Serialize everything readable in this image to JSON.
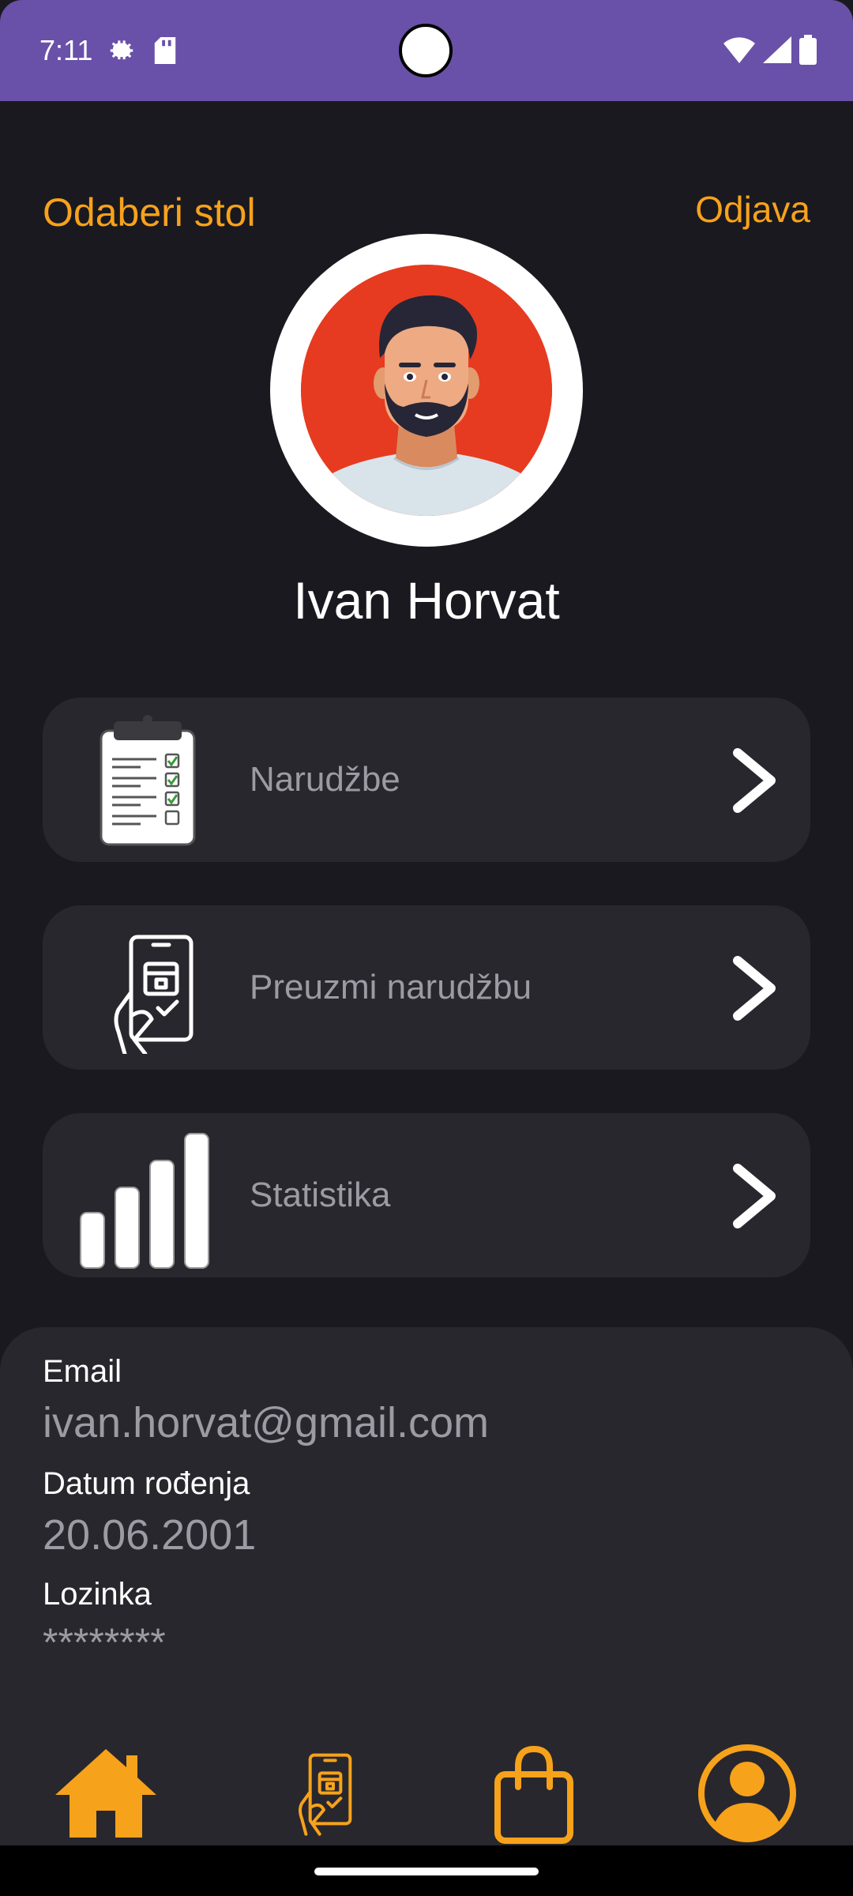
{
  "status_bar": {
    "time": "7:11",
    "icons": [
      "settings-gear-icon",
      "sd-card-icon",
      "wifi-icon",
      "signal-icon",
      "battery-icon"
    ]
  },
  "header": {
    "select_table_link": "Odaberi stol",
    "logout_link": "Odjava"
  },
  "profile": {
    "name": "Ivan Horvat",
    "avatar": "man-avatar-illustration"
  },
  "menu": {
    "items": [
      {
        "label": "Narudžbe",
        "icon": "clipboard-checklist-icon"
      },
      {
        "label": "Preuzmi narudžbu",
        "icon": "hand-phone-package-icon"
      },
      {
        "label": "Statistika",
        "icon": "bar-chart-icon"
      }
    ]
  },
  "info": {
    "email_label": "Email",
    "email_value": "ivan.horvat@gmail.com",
    "dob_label": "Datum rođenja",
    "dob_value": "20.06.2001",
    "password_label": "Lozinka",
    "password_value": "********"
  },
  "bottom_nav": {
    "items": [
      {
        "icon": "home-icon"
      },
      {
        "icon": "hand-phone-package-icon"
      },
      {
        "icon": "shopping-bag-icon"
      },
      {
        "icon": "user-profile-icon"
      }
    ]
  },
  "colors": {
    "accent": "#f7a21b",
    "status_bar": "#6950a8",
    "background": "#1a191f",
    "card": "#28272d",
    "muted_text": "#9c9ba4"
  }
}
